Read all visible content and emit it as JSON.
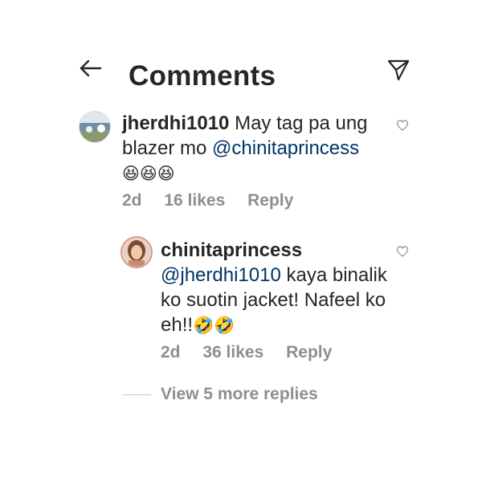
{
  "header": {
    "title": "Comments",
    "back_icon": "arrow-left-icon",
    "share_icon": "paper-plane-icon"
  },
  "comments": [
    {
      "username": "jherdhi1010",
      "text_before": "May tag pa ung blazer mo",
      "mention": "@chinitaprincess",
      "emoji": "😆😆😆",
      "time": "2d",
      "likes": "16 likes",
      "reply": "Reply"
    },
    {
      "username": "chinitaprincess",
      "mention": "@jherdhi1010",
      "text_after": "kaya binalik ko suotin jacket! Nafeel ko eh!!",
      "emoji": "🤣🤣",
      "time": "2d",
      "likes": "36 likes",
      "reply": "Reply"
    }
  ],
  "view_more": "View 5 more replies",
  "colors": {
    "text": "#262626",
    "mention": "#003569",
    "meta": "#8e8e8e"
  }
}
